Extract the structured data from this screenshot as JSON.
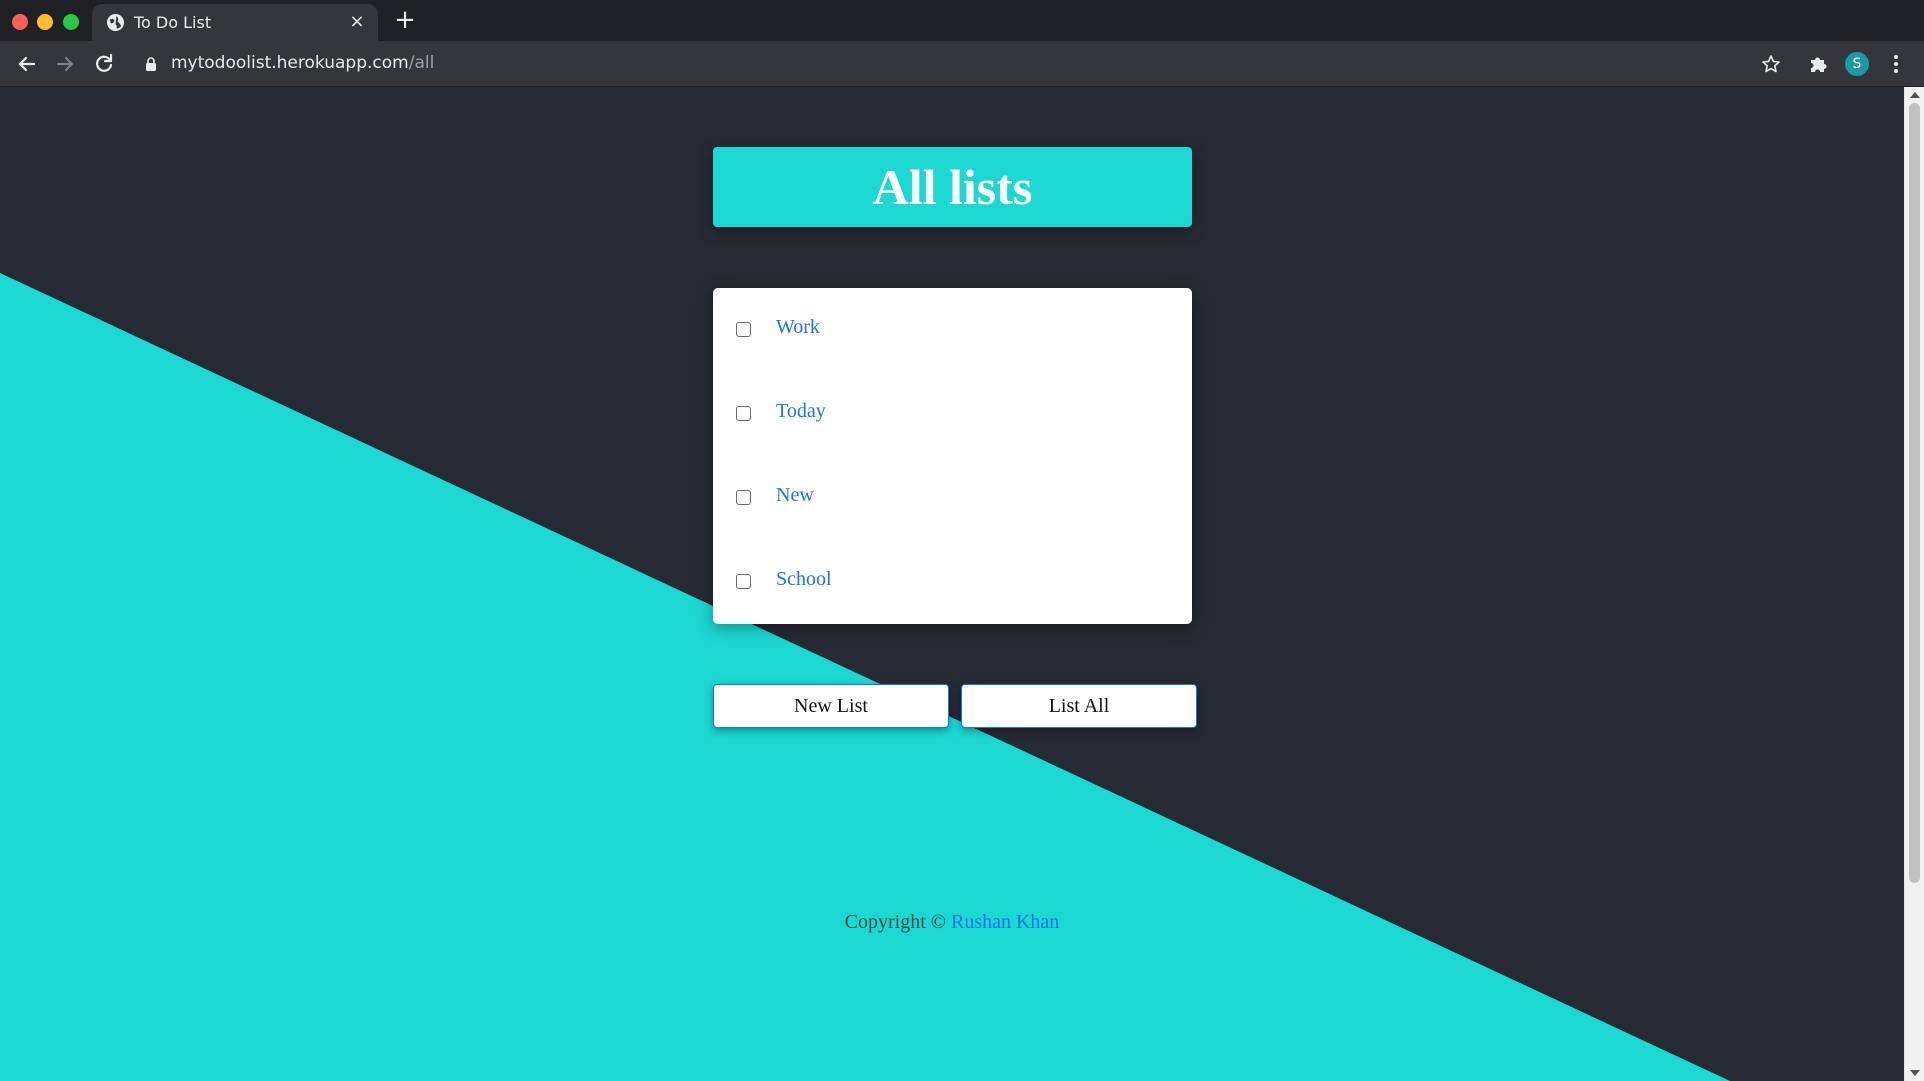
{
  "browser": {
    "tab_title": "To Do List",
    "tab_close": "×",
    "new_tab": "+",
    "url_host": "mytodoolist.herokuapp.com",
    "url_path": "/all",
    "profile_initial": "S"
  },
  "page": {
    "title": "All lists",
    "lists": [
      {
        "label": "Work",
        "checked": false
      },
      {
        "label": "Today",
        "checked": false
      },
      {
        "label": "New",
        "checked": false
      },
      {
        "label": "School",
        "checked": false
      }
    ],
    "buttons": {
      "new_list": "New List",
      "list_all": "List All"
    },
    "footer": {
      "copyright": "Copyright ©",
      "author": "Rushan Khan"
    }
  },
  "colors": {
    "background": "#262a33",
    "accent": "#1cd8d2",
    "link": "#1a73e8"
  }
}
